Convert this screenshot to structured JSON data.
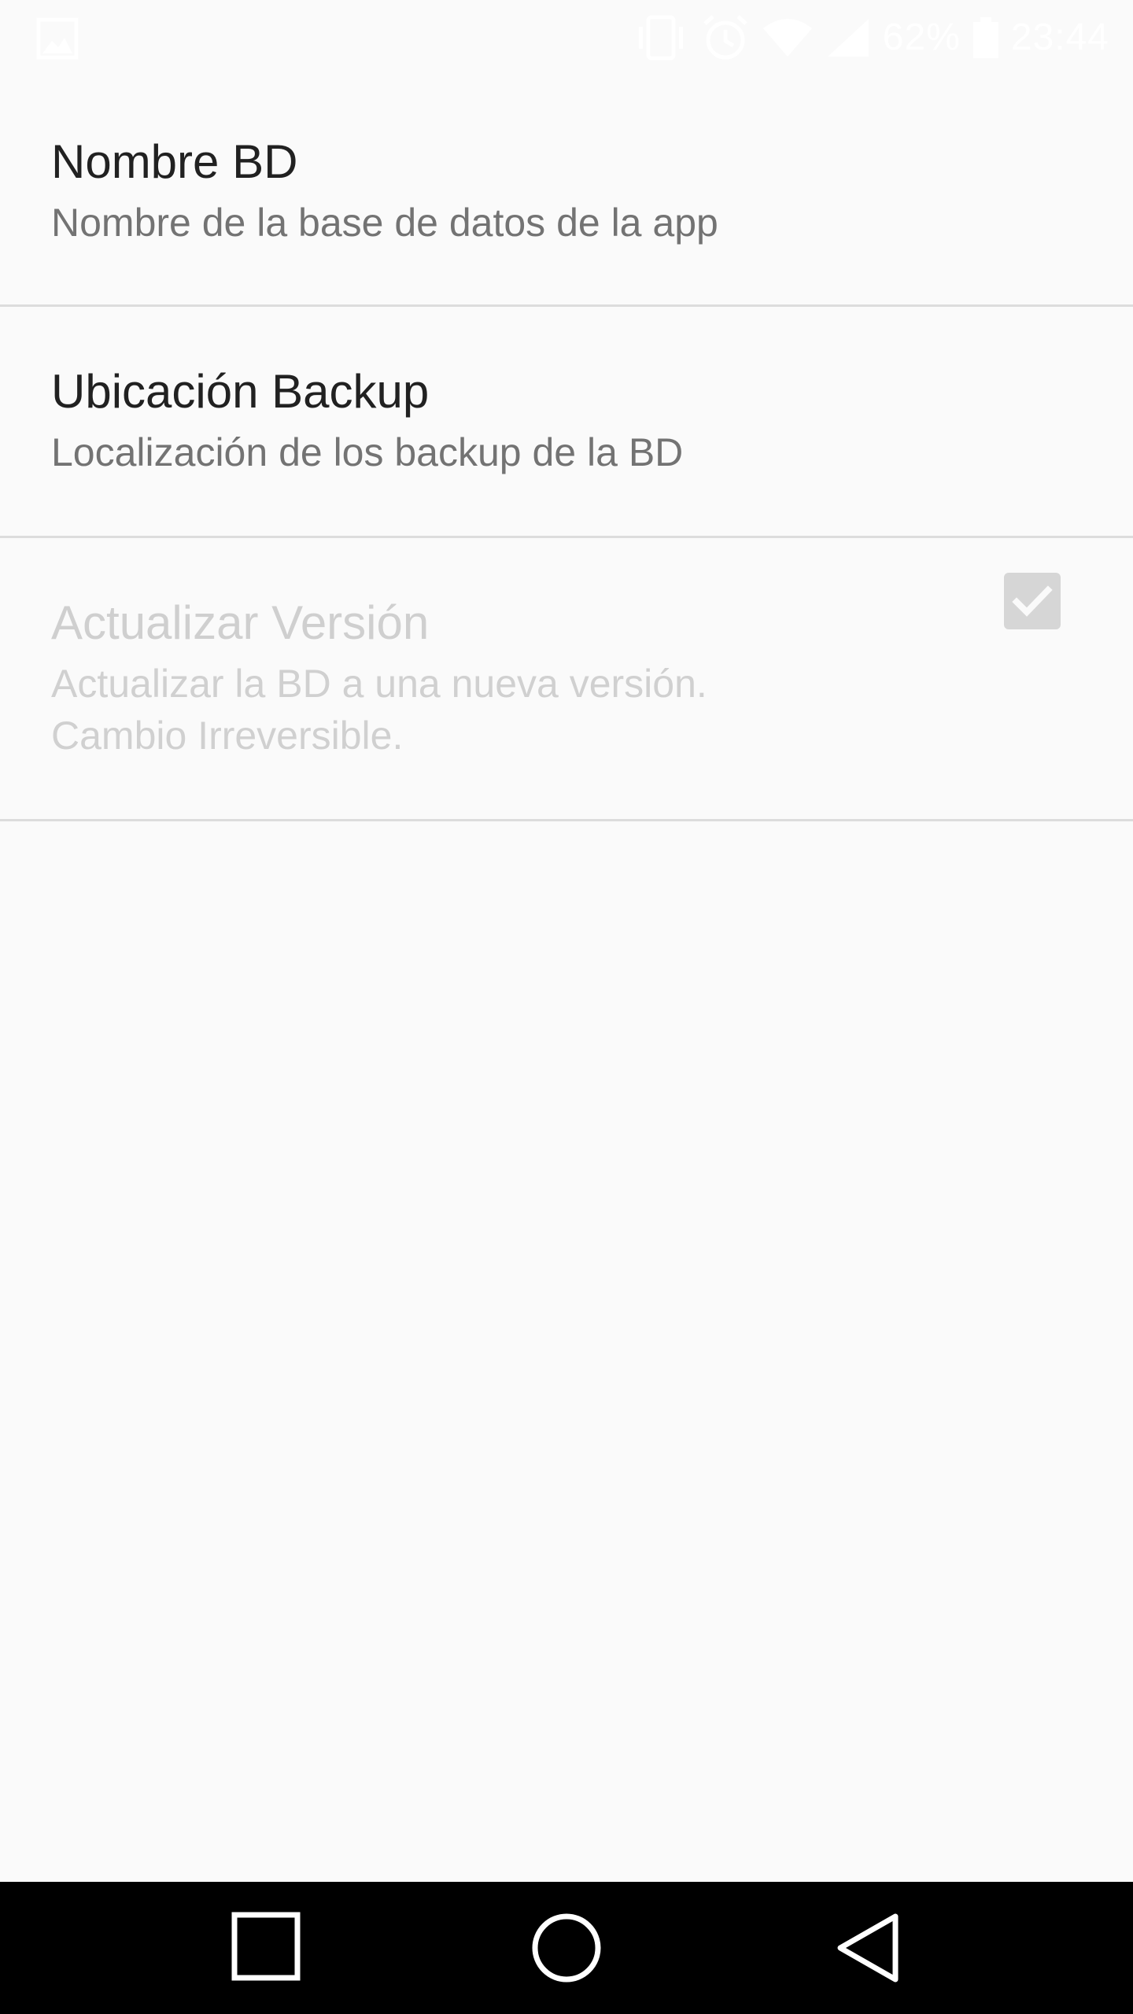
{
  "status_bar": {
    "battery_level": "62%",
    "time": "23:44",
    "icons": [
      "image-notification-icon",
      "vibrate-icon",
      "alarm-icon",
      "wifi-icon",
      "signal-icon",
      "battery-icon"
    ]
  },
  "preferences": [
    {
      "title": "Nombre BD",
      "summary": "Nombre de la base de datos de la app",
      "enabled": true
    },
    {
      "title": "Ubicación Backup",
      "summary": "Localización de los backup de la BD",
      "enabled": true
    },
    {
      "title": "Actualizar Versión",
      "summary": "Actualizar la BD a una nueva versión.\nCambio Irreversible.",
      "enabled": false,
      "checked": true
    }
  ],
  "navigation": {
    "buttons": [
      "recents-icon",
      "home-icon",
      "back-icon"
    ]
  },
  "colors": {
    "background": "#fafafa",
    "title_text": "#212121",
    "summary_text": "#737373",
    "disabled_text": "#cfcfcf",
    "divider": "#dcdcdc",
    "nav_bar": "#000000"
  }
}
